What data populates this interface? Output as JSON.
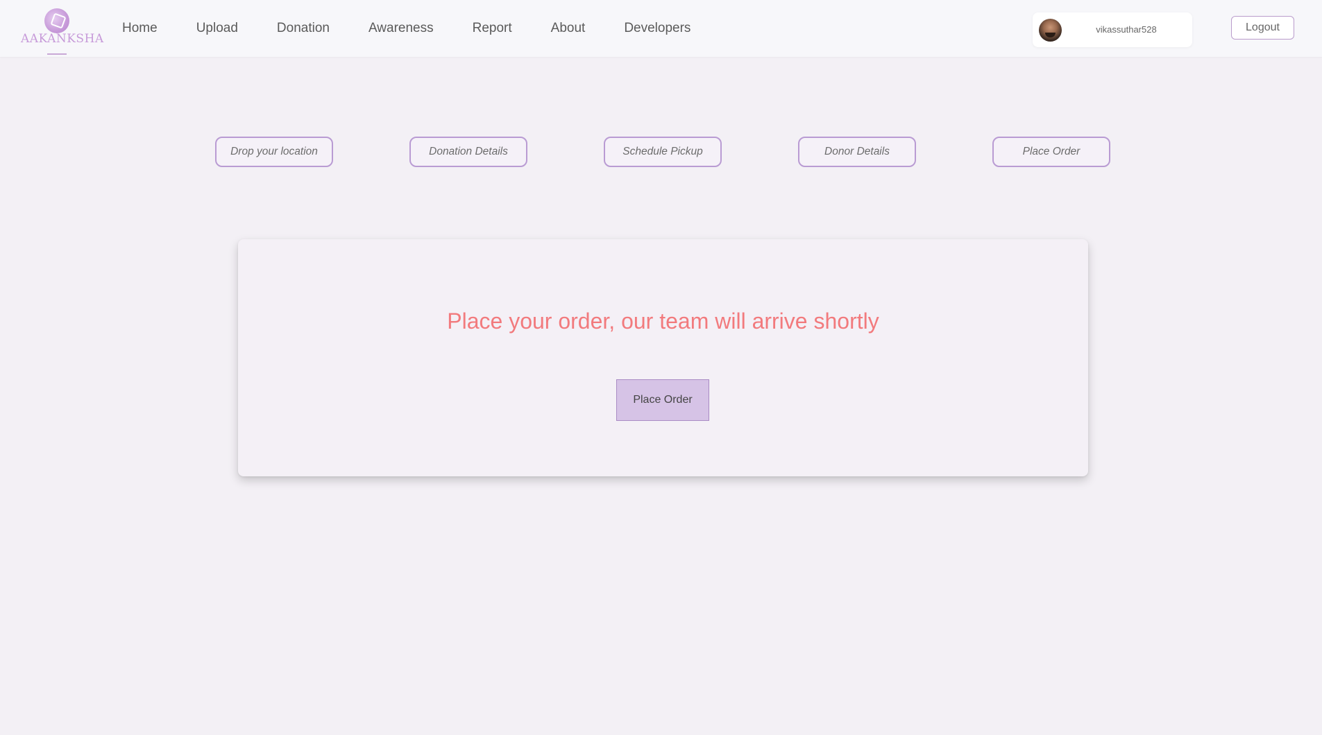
{
  "brand": {
    "name": "AAKANKSHA"
  },
  "nav": {
    "links": [
      "Home",
      "Upload",
      "Donation",
      "Awareness",
      "Report",
      "About",
      "Developers"
    ]
  },
  "user": {
    "username": "vikassuthar528"
  },
  "header": {
    "logout_label": "Logout"
  },
  "steps": [
    "Drop your location",
    "Donation Details",
    "Schedule Pickup",
    "Donor Details",
    "Place Order"
  ],
  "card": {
    "heading": "Place your order, our team will arrive shortly",
    "button_label": "Place Order"
  },
  "colors": {
    "accent": "#b99bd3",
    "heading": "#f27a7d",
    "button_bg": "#d6c3e6",
    "page_bg": "#f3f0f5"
  }
}
